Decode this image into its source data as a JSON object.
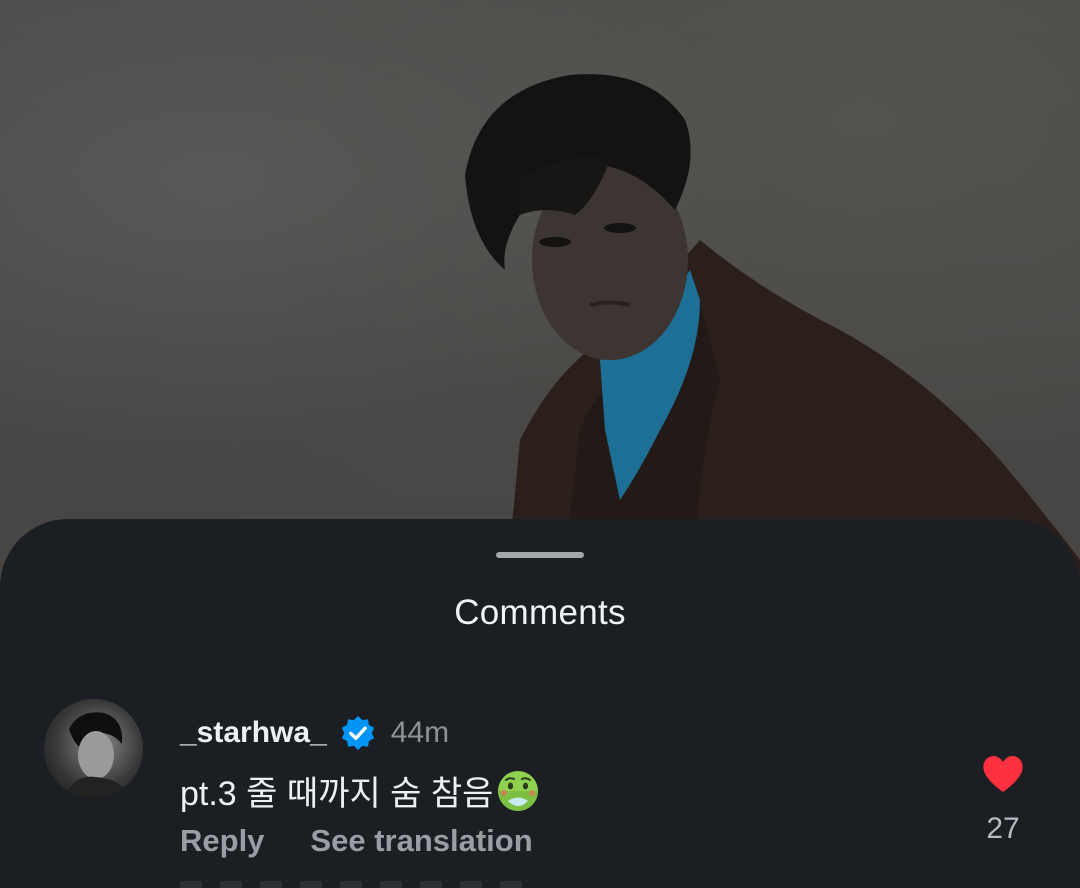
{
  "sheet": {
    "title": "Comments"
  },
  "comment": {
    "username": "_starhwa_",
    "verified": true,
    "timestamp": "44m",
    "text": "pt.3 줄 때까지 숨 참음",
    "emoji": "nauseated-face",
    "actions": {
      "reply": "Reply",
      "translate": "See translation"
    },
    "likes": "27",
    "liked": true
  },
  "colors": {
    "sheet_bg": "#1b1e22",
    "heart": "#ff3040",
    "verified": "#0095f6",
    "muted_text": "#9a9ea4"
  }
}
